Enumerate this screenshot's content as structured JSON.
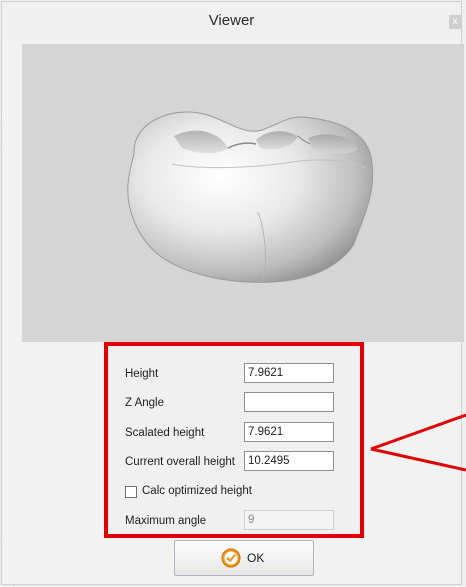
{
  "window": {
    "title": "Viewer",
    "close_glyph": "x"
  },
  "viewer": {
    "icon": "tooth-model-3d"
  },
  "parameters": {
    "height": {
      "label": "Height",
      "value": "7.9621"
    },
    "z_angle": {
      "label": "Z Angle",
      "value": ""
    },
    "scalated_height": {
      "label": "Scalated height",
      "value": "7.9621"
    },
    "current_overall_height": {
      "label": "Current overall height",
      "value": "10.2495"
    },
    "calc_optimized": {
      "label": "Calc optimized height",
      "checked": false
    },
    "maximum_angle": {
      "label": "Maximum angle",
      "value": "9"
    }
  },
  "ok_button": {
    "label": "OK",
    "icon": "check-circle-icon"
  },
  "highlight": {
    "color": "#e00000"
  }
}
